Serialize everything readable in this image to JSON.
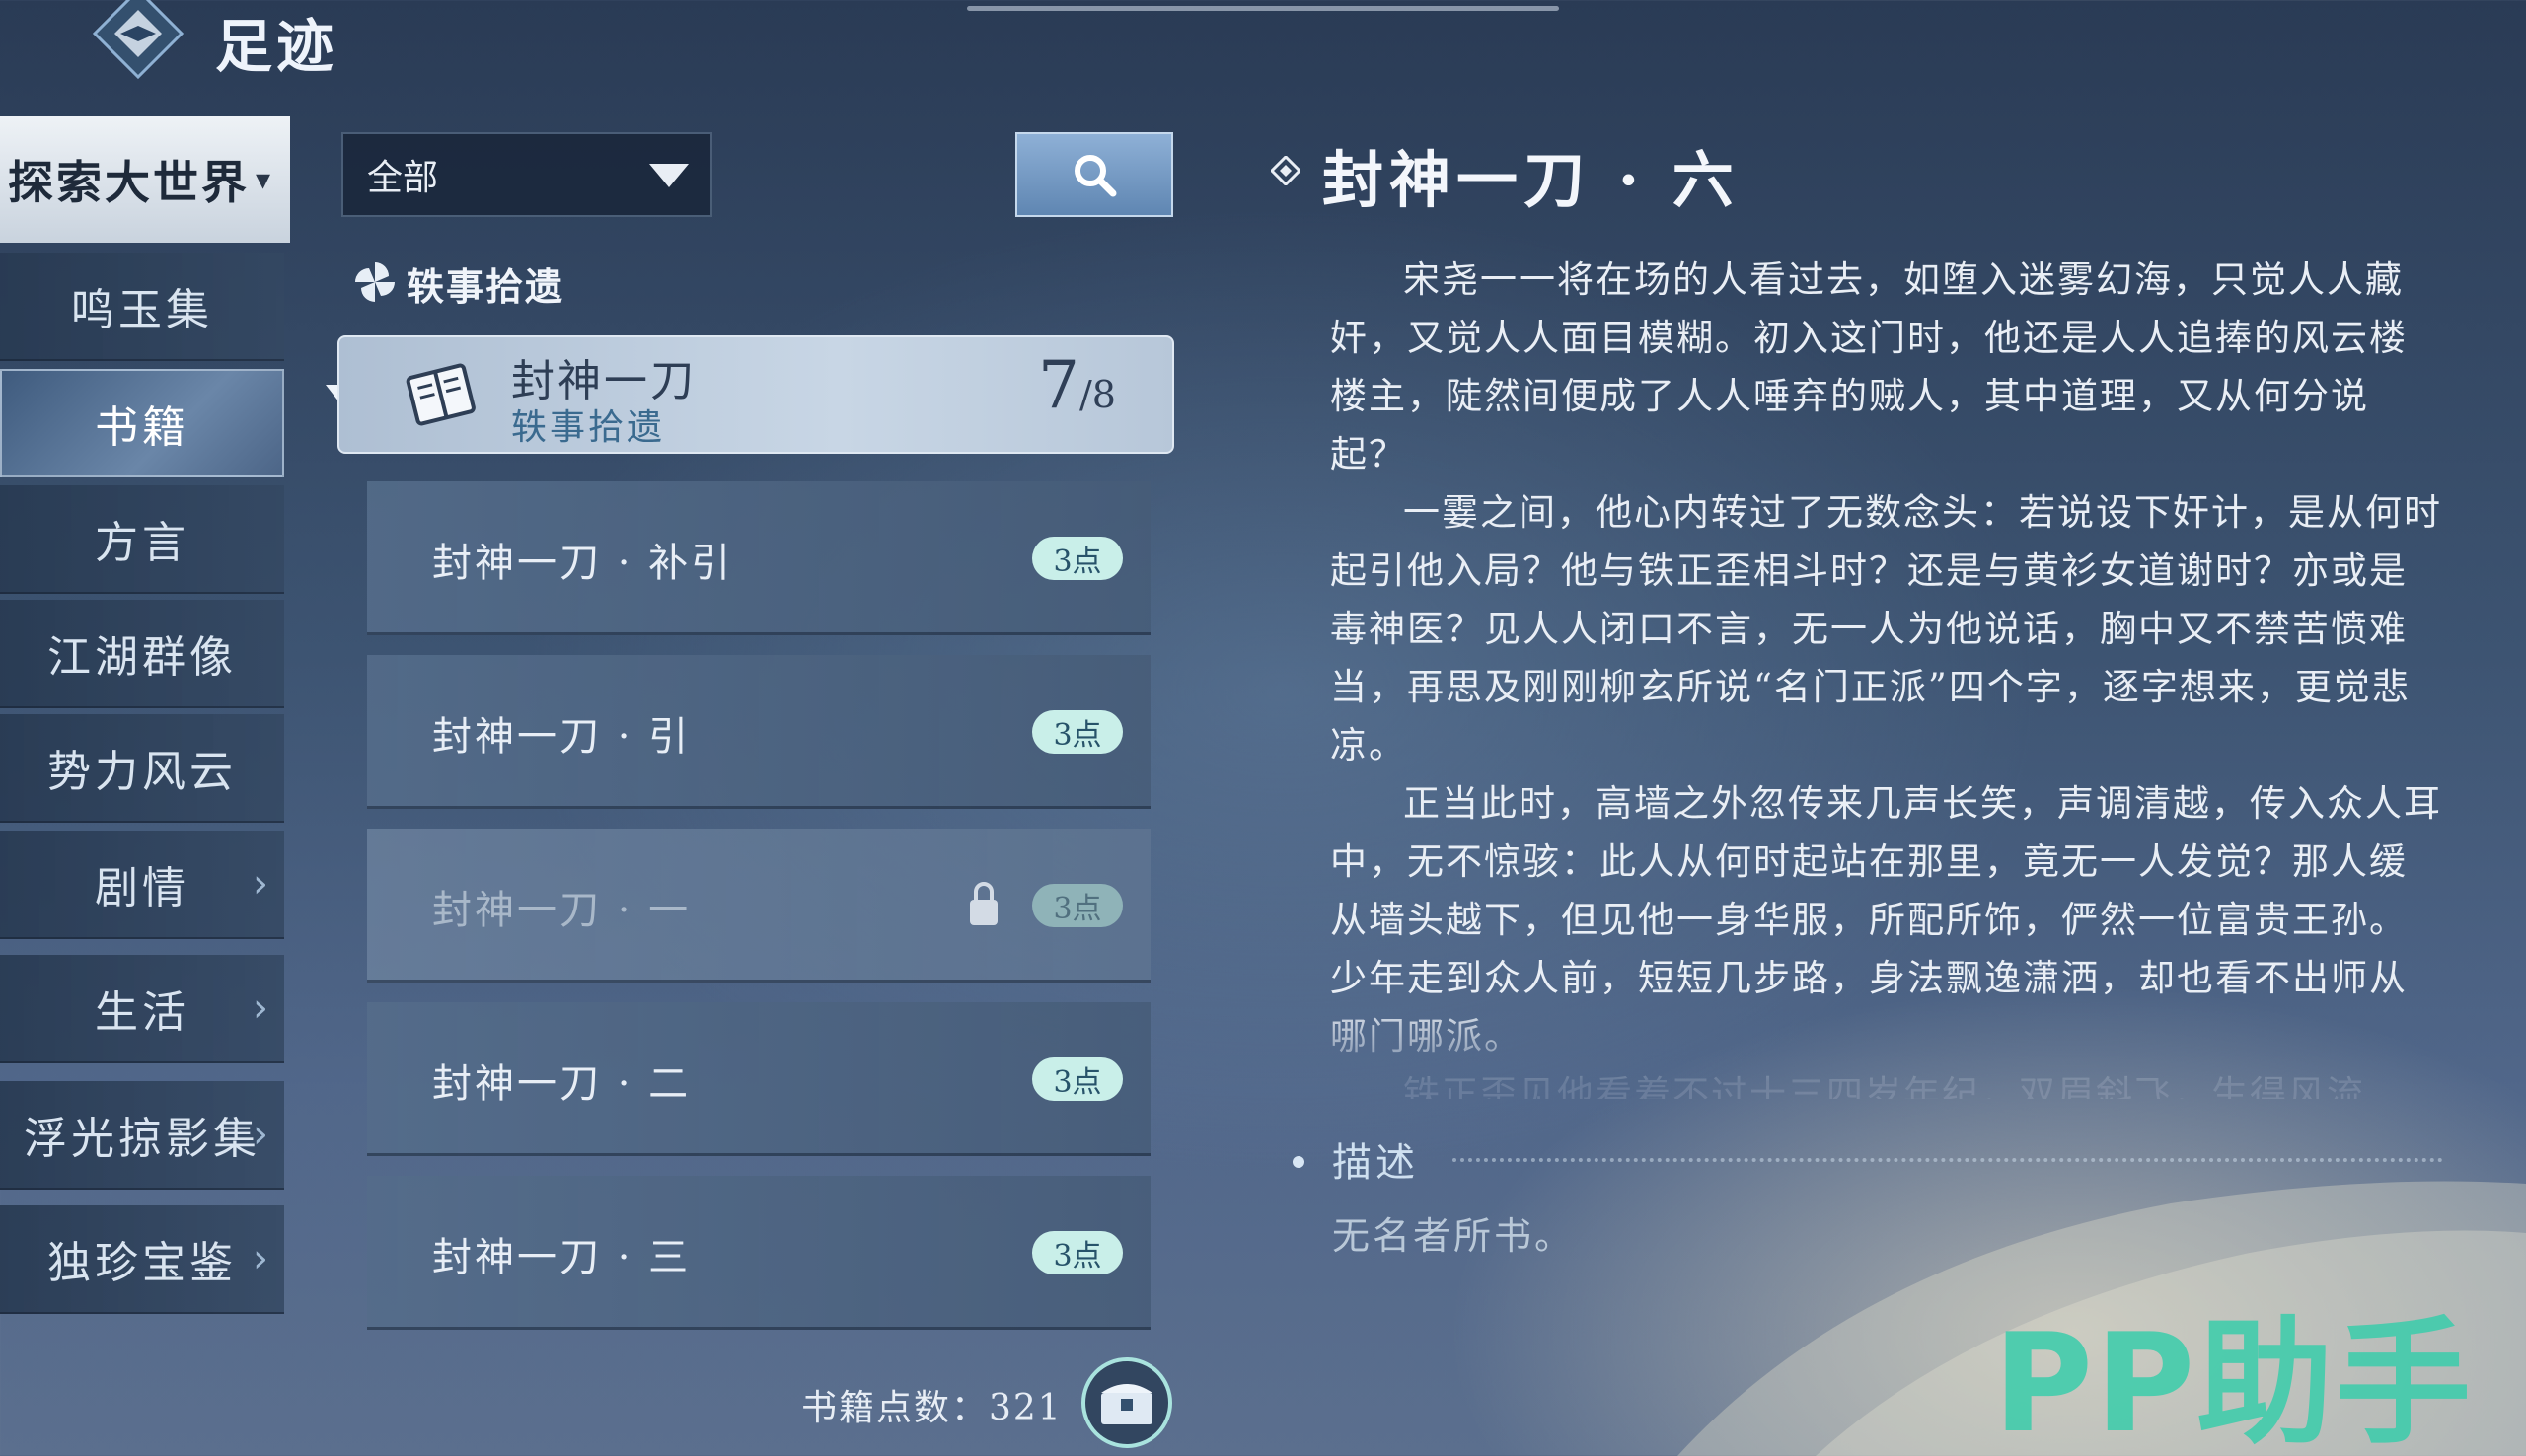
{
  "header": {
    "title": "足迹",
    "logo_icon": "diamond-emblem-icon"
  },
  "sidebar": {
    "top": {
      "label": "探索大世界",
      "icon": "caret-down-icon"
    },
    "items": [
      {
        "label": "鸣玉集",
        "arrow": false,
        "active": false
      },
      {
        "label": "书籍",
        "arrow": false,
        "active": true
      },
      {
        "label": "方言",
        "arrow": false,
        "active": false
      },
      {
        "label": "江湖群像",
        "arrow": false,
        "active": false
      },
      {
        "label": "势力风云",
        "arrow": false,
        "active": false
      },
      {
        "label": "剧情",
        "arrow": true,
        "active": false
      },
      {
        "label": "生活",
        "arrow": true,
        "active": false
      },
      {
        "label": "浮光掠影集",
        "arrow": true,
        "active": false
      },
      {
        "label": "独珍宝鉴",
        "arrow": true,
        "active": false
      }
    ],
    "arrow_glyph": "›"
  },
  "filter": {
    "value": "全部",
    "icon": "dropdown-triangle-icon"
  },
  "search": {
    "icon": "search-icon"
  },
  "section": {
    "label": "轶事拾遗",
    "icon": "pinwheel-icon"
  },
  "group": {
    "title": "封神一刀",
    "subtitle": "轶事拾遗",
    "count": "7",
    "total": "/8",
    "icon": "book-icon"
  },
  "list": [
    {
      "label": "封神一刀 · 补引",
      "badge": "3点",
      "locked": false
    },
    {
      "label": "封神一刀 · 引",
      "badge": "3点",
      "locked": false
    },
    {
      "label": "封神一刀 · 一",
      "badge": "3点",
      "locked": true
    },
    {
      "label": "封神一刀 · 二",
      "badge": "3点",
      "locked": false
    },
    {
      "label": "封神一刀 · 三",
      "badge": "3点",
      "locked": false
    }
  ],
  "footer": {
    "points_label": "书籍点数：321",
    "icon": "chest-icon"
  },
  "detail": {
    "title": "封神一刀 · 六",
    "paragraphs": [
      "宋尧一一将在场的人看过去，如堕入迷雾幻海，只觉人人藏奸，又觉人人面目模糊。初入这门时，他还是人人追捧的风云楼楼主，陡然间便成了人人唾弃的贼人，其中道理，又从何分说起？",
      "一霎之间，他心内转过了无数念头：若说设下奸计，是从何时起引他入局？他与铁正歪相斗时？还是与黄衫女道谢时？亦或是毒神医？见人人闭口不言，无一人为他说话，胸中又不禁苦愤难当，再思及刚刚柳玄所说“名门正派”四个字，逐字想来，更觉悲凉。",
      "正当此时，高墙之外忽传来几声长笑，声调清越，传入众人耳中，无不惊骇：此人从何时起站在那里，竟无一人发觉？那人缓从墙头越下，但见他一身华服，所配所饰，俨然一位富贵王孙。少年走到众人前，短短几步路，身法飘逸潇洒，却也看不出师从哪门哪派。",
      "铁正歪见他看着不过十三四岁年纪，双眉斜飞，生得风流"
    ],
    "desc_label": "描述",
    "desc_text": "无名者所书。"
  },
  "watermark": "PP助手"
}
